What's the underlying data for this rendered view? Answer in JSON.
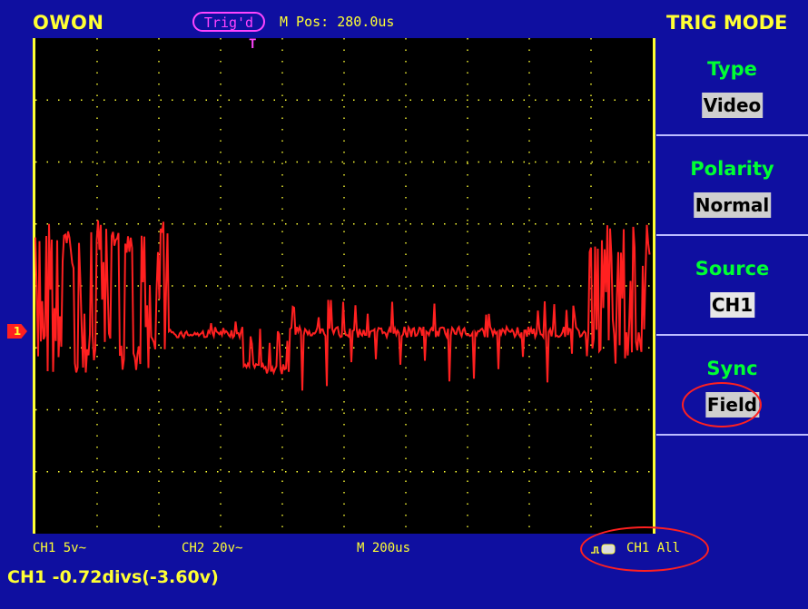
{
  "header": {
    "brand": "OWON",
    "trigger_status": "Trig'd",
    "main_position": "M Pos: 280.0us",
    "mode_title": "TRIG MODE"
  },
  "menu": [
    {
      "label": "Type",
      "value": "Video"
    },
    {
      "label": "Polarity",
      "value": "Normal"
    },
    {
      "label": "Source",
      "value": "CH1"
    },
    {
      "label": "Sync",
      "value": "Field"
    }
  ],
  "bottom": {
    "ch1_scale": "CH1 5v~",
    "ch2_scale": "CH2 20v~",
    "timebase": "M 200us",
    "trigger_source": "CH1 All",
    "status": "CH1 -0.72divs(-3.60v)"
  },
  "markers": {
    "channel": "1",
    "trigger": "T"
  },
  "colors": {
    "background": "#0f0fa0",
    "trace": "#ff2020",
    "accent": "#ffff33",
    "menu_label": "#00ff33",
    "trigger": "#ff44ff"
  }
}
